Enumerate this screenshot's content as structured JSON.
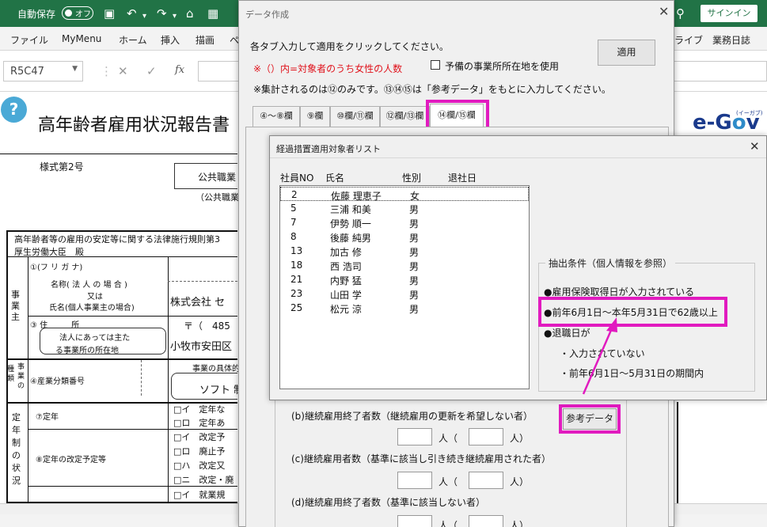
{
  "excel": {
    "autosave_label": "自動保存",
    "autosave_state": "オフ",
    "signin_label": "サインイン",
    "menu": [
      "ファイル",
      "MyMenu",
      "ホーム",
      "挿入",
      "描画",
      "ペ"
    ],
    "menu_right": [
      "ライブ",
      "業務日誌"
    ],
    "namebox": "R5C47",
    "fx_label": "fx"
  },
  "sheet": {
    "title": "高年齢者雇用状況報告書",
    "form_no": "様式第2号",
    "office_label": "公共職業",
    "office_sub": "（公共職業",
    "law_text": "高年齢者等の雇用の安定等に関する法律施行規則第3",
    "minister": "厚生労働大臣　殿",
    "furigana": "①(フ リ ガ ナ)",
    "name_label_1": "名称( 法 人 の 場 合 )",
    "name_label_2": "又は",
    "name_label_3": "氏名(個人事業主の場合)",
    "company": "株式会社 セ",
    "address_label": "③ 住　　　所",
    "address_note_1": "法人にあっては主た",
    "address_note_2": "る事業所の所在地",
    "postal": "〒（　485",
    "address": "小牧市安田区",
    "industry_label": "④産業分類番号",
    "business_detail": "事業の具体的",
    "business_value": "ソフト 制",
    "jigyo": [
      "事",
      "業",
      "主"
    ],
    "shurui": [
      "種",
      "類"
    ],
    "jigyo2": [
      "事",
      "業",
      "の"
    ],
    "teinen_side": [
      "定",
      "年",
      "制",
      "の",
      "状",
      "況"
    ],
    "teinen_label": "⑦定年",
    "teinen_change": "⑧定年の改定予定等",
    "checks": [
      {
        "k": "□イ",
        "v": "定年な"
      },
      {
        "k": "□ロ",
        "v": "定年あ"
      },
      {
        "k": "□イ",
        "v": "改定予"
      },
      {
        "k": "□ロ",
        "v": "廃止予"
      },
      {
        "k": "□ハ",
        "v": "改定又"
      },
      {
        "k": "□ニ",
        "v": "改定・廃"
      },
      {
        "k": "□イ",
        "v": "就業規"
      }
    ],
    "egov": {
      "e": "e-G",
      "o": "o",
      "v": "v",
      "sub": "(イーガブ)"
    }
  },
  "dialog": {
    "title": "データ作成",
    "instruction": "各タブ入力して適用をクリックしてください。",
    "female_note": "※（）内=対象者のうち女性の人数",
    "checkbox_label": "予備の事業所所在地を使用",
    "aggregate_note": "※集計されるのは⑫のみです。⑬⑭⑮は「参考データ」をもとに入力してください。",
    "apply_button": "適用",
    "tabs": [
      "④～⑧欄",
      "⑨欄",
      "⑩欄/⑪欄",
      "⑫欄/⑬欄",
      "⑭欄/⑮欄"
    ],
    "fields": [
      {
        "label": "(b)継続雇用終了者数（継続雇用の更新を希望しない者）"
      },
      {
        "label": "(c)継続雇用者数（基準に該当し引き続き継続雇用された者）"
      },
      {
        "label": "(d)継続雇用終了者数（基準に該当しない者）"
      }
    ],
    "unit_open": "人（",
    "unit_close": "人）",
    "ref_button": "参考データ"
  },
  "subdialog": {
    "title": "経過措置適用対象者リスト",
    "columns": [
      "社員NO",
      "氏名",
      "性別",
      "退社日"
    ],
    "rows": [
      {
        "no": "2",
        "name": "佐藤 理恵子",
        "gender": "女",
        "retire": ""
      },
      {
        "no": "5",
        "name": "三浦 和美",
        "gender": "男",
        "retire": ""
      },
      {
        "no": "7",
        "name": "伊勢 順一",
        "gender": "男",
        "retire": ""
      },
      {
        "no": "8",
        "name": "後藤 純男",
        "gender": "男",
        "retire": ""
      },
      {
        "no": "13",
        "name": "加古 修",
        "gender": "男",
        "retire": ""
      },
      {
        "no": "18",
        "name": "西 浩司",
        "gender": "男",
        "retire": ""
      },
      {
        "no": "21",
        "name": "内野 猛",
        "gender": "男",
        "retire": ""
      },
      {
        "no": "23",
        "name": "山田 学",
        "gender": "男",
        "retire": ""
      },
      {
        "no": "25",
        "name": "松元 涼",
        "gender": "男",
        "retire": ""
      }
    ],
    "condition_title": "抽出条件（個人情報を参照）",
    "conditions": [
      "●雇用保険取得日が入力されている",
      "●前年6月1日～本年5月31日で62歳以上",
      "●退職日が",
      "・入力されていない",
      "・前年6月1日～5月31日の期間内"
    ]
  },
  "colors": {
    "excel_green": "#217346",
    "highlight": "#e11bbf",
    "note_red": "#e0121b"
  }
}
